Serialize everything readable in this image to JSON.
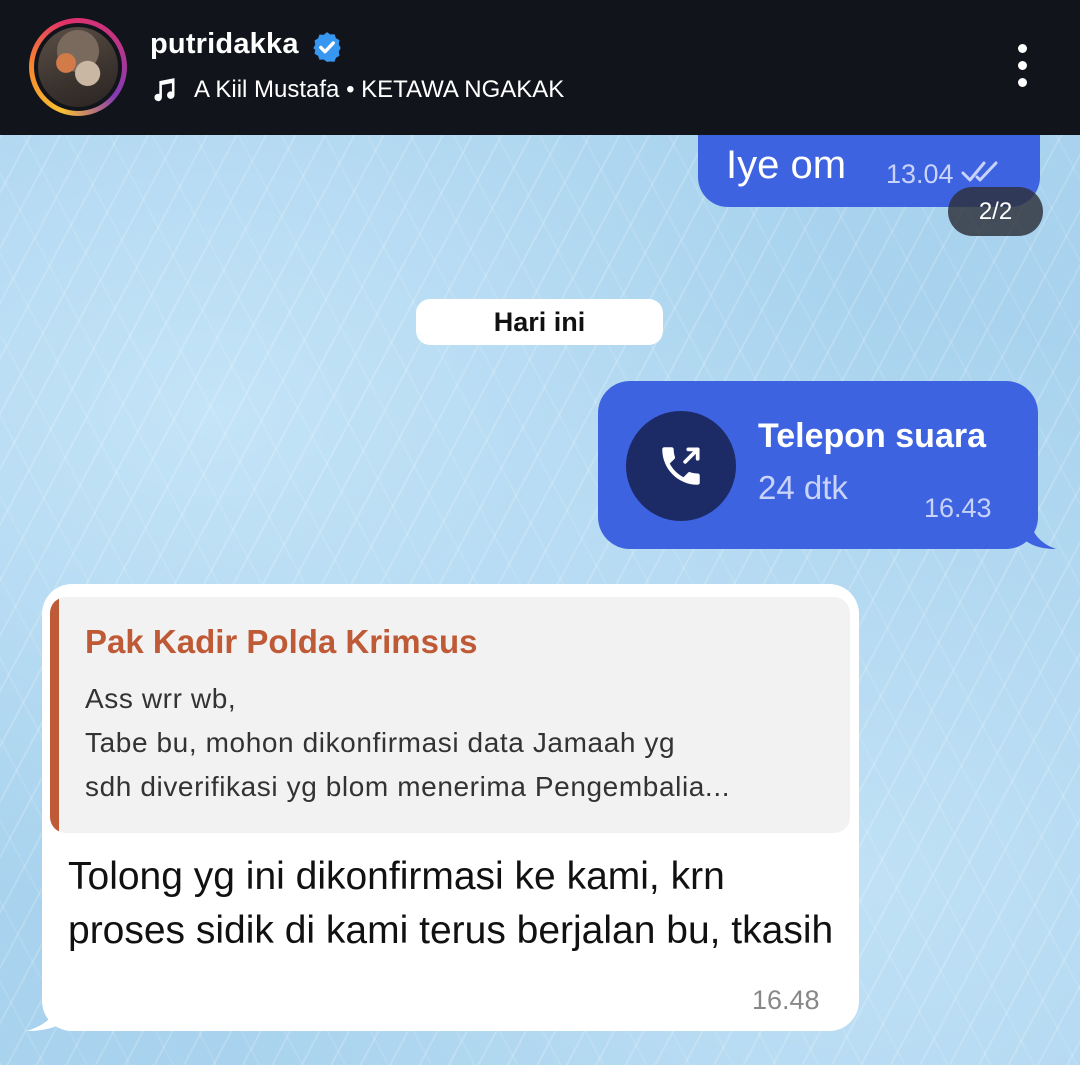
{
  "header": {
    "username": "putridakka",
    "music_line": "A Kiil Mustafa • KETAWA NGAKAK",
    "icons": {
      "avatar": "profile-avatar",
      "verified": "verified-badge-icon",
      "music": "music-note-icon",
      "more": "more-options-icon"
    },
    "colors": {
      "background": "#11141a",
      "verified": "#3897f0"
    }
  },
  "page_counter": "2/2",
  "messages": [
    {
      "type": "outgoing",
      "text": "Iye om",
      "time": "13.04"
    },
    {
      "type": "date_separator",
      "text": "Hari ini"
    },
    {
      "type": "outgoing_call",
      "title": "Telepon suara",
      "duration": "24 dtk",
      "time": "16.43"
    },
    {
      "type": "incoming",
      "reply": {
        "sender": "Pak Kadir Polda Krimsus",
        "text": "Ass wrr wb,\nTabe bu, mohon dikonfirmasi data Jamaah yg\nsdh diverifikasi yg blom menerima Pengembalia..."
      },
      "text": "Tolong yg ini dikonfirmasi ke kami, krn proses sidik di kami terus berjalan bu, tkasih",
      "time": "16.48"
    }
  ],
  "colors": {
    "outgoing_bubble": "#3e63e0",
    "incoming_bubble": "#ffffff",
    "reply_accent": "#bf5a36",
    "chat_background": "#a8d2ee"
  }
}
